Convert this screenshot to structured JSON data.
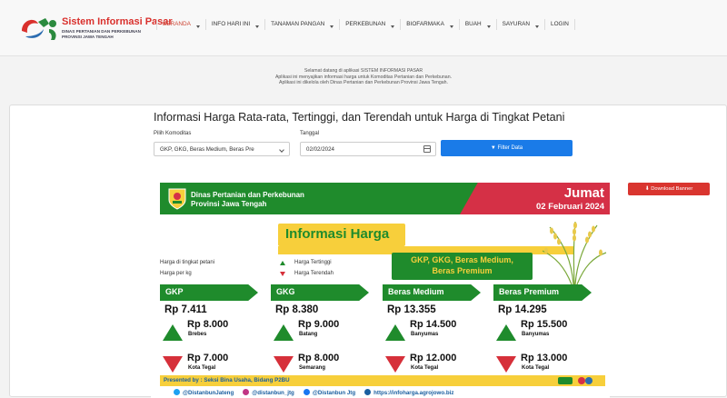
{
  "header": {
    "logo_title": "Sistem Informasi Pasar",
    "logo_subtitle": "Dinas Pertanian dan Perkebunan Provinsi Jawa Tengah",
    "nav": [
      {
        "label": "BERANDA",
        "dropdown": true,
        "active": true
      },
      {
        "label": "INFO HARI INI",
        "dropdown": true
      },
      {
        "label": "TANAMAN PANGAN",
        "dropdown": true
      },
      {
        "label": "PERKEBUNAN",
        "dropdown": true
      },
      {
        "label": "BIOFARMAKA",
        "dropdown": true
      },
      {
        "label": "BUAH",
        "dropdown": true
      },
      {
        "label": "SAYURAN",
        "dropdown": true
      },
      {
        "label": "LOGIN",
        "dropdown": false
      }
    ]
  },
  "welcome": {
    "line1": "Selamat datang di aplikasi SISTEM INFORMASI PASAR",
    "line2": "Aplikasi ini menyajikan informasi harga untuk Komoditas Pertanian dan Perkebunan.",
    "line3": "Aplikasi ini dikelola oleh Dinas Pertanian dan Perkebunan Provinsi Jawa Tengah."
  },
  "main": {
    "title": "Informasi Harga Rata-rata, Tertinggi, dan Terendah untuk Harga di Tingkat Petani",
    "komoditas_label": "Pilih Komoditas",
    "komoditas_value": "GKP, GKG, Beras Medium, Beras Pre",
    "tanggal_label": "Tanggal",
    "tanggal_value": "02/02/2024",
    "filter_label": "Filter Data",
    "download_label": "Download Banner"
  },
  "banner": {
    "org_line1": "Dinas Pertanian dan Perkebunan",
    "org_line2": "Provinsi Jawa Tengah",
    "day": "Jumat",
    "date": "02 Februari 2024",
    "info_title": "Informasi Harga",
    "legend_left1": "Harga di tingkat petani",
    "legend_left2": "Harga per kg",
    "legend_up": "Harga Tertinggi",
    "legend_down": "Harga Terendah",
    "commodity_line1": "GKP, GKG, Beras Medium,",
    "commodity_line2": "Beras Premium",
    "columns": [
      {
        "name": "GKP",
        "avg": "Rp 7.411",
        "high": "Rp 8.000",
        "high_loc": "Brebes",
        "low": "Rp 7.000",
        "low_loc": "Kota Tegal"
      },
      {
        "name": "GKG",
        "avg": "Rp 8.380",
        "high": "Rp 9.000",
        "high_loc": "Batang",
        "low": "Rp 8.000",
        "low_loc": "Semarang"
      },
      {
        "name": "Beras Medium",
        "avg": "Rp 13.355",
        "high": "Rp 14.500",
        "high_loc": "Banyumas",
        "low": "Rp 12.000",
        "low_loc": "Kota Tegal"
      },
      {
        "name": "Beras Premium",
        "avg": "Rp 14.295",
        "high": "Rp 15.500",
        "high_loc": "Banyumas",
        "low": "Rp 13.000",
        "low_loc": "Kota Tegal"
      }
    ],
    "presented_by": "Presented by : Seksi Bina Usaha, Bidang P2BU",
    "social": {
      "twitter": "@DistanbunJateng",
      "instagram": "@distanbun_jtg",
      "facebook": "@Distanbun Jtg",
      "web": "https://infoharga.agrojowo.biz"
    }
  },
  "colors": {
    "green": "#1f8b2c",
    "red": "#d53046",
    "yellow": "#f7cf3b",
    "blue": "#1a7be8"
  }
}
